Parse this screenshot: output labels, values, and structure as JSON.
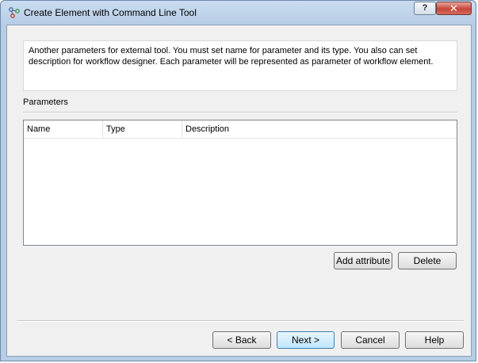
{
  "window": {
    "title": "Create Element with Command Line Tool",
    "help_label": "?",
    "close_label": "✕"
  },
  "description": "Another parameters for external tool. You must set name for parameter and its type. You also can set description for workflow designer. Each parameter will be represented as  parameter of workflow element.",
  "parameters": {
    "group_label": "Parameters",
    "columns": [
      "Name",
      "Type",
      "Description"
    ],
    "rows": []
  },
  "actions": {
    "add_attribute": "Add attribute",
    "delete": "Delete"
  },
  "footer": {
    "back": "< Back",
    "next": "Next >",
    "cancel": "Cancel",
    "help": "Help"
  },
  "icons": {
    "app": "workflow-elements-icon",
    "help": "question-mark-icon",
    "close": "close-icon"
  },
  "colors": {
    "title_bar": "#b7cde6",
    "close_button": "#c7463a",
    "primary_button_border": "#3c7fb1",
    "client_background": "#f0f0f0"
  }
}
